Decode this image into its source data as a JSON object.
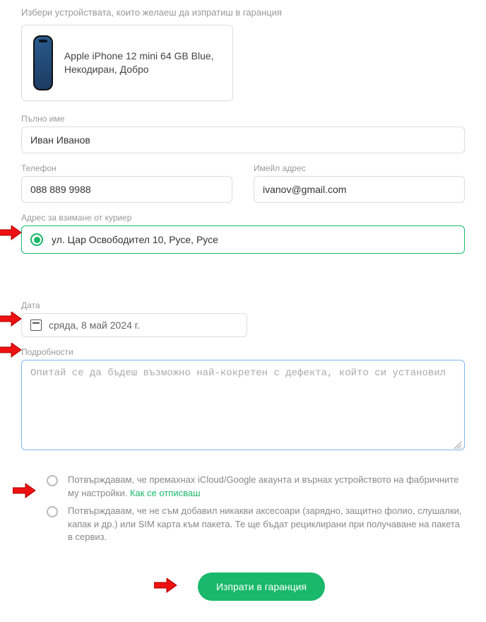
{
  "heading": "Избери устройствата, които желаеш да изпратиш в гаранция",
  "device": {
    "title": "Apple iPhone 12 mini 64 GB Blue, Некодиран, Добро"
  },
  "fields": {
    "full_name_label": "Пълно име",
    "full_name_value": "Иван Иванов",
    "phone_label": "Телефон",
    "phone_value": "088 889 9988",
    "email_label": "Имейл адрес",
    "email_value": "ivanov@gmail.com",
    "pickup_label": "Адрес за взимане от куриер",
    "pickup_value": "ул. Цар Освободител 10, Русе, Русе",
    "date_label": "Дата",
    "date_value": "сряда, 8 май 2024 г.",
    "details_label": "Подробности",
    "details_placeholder": "Опитай се да бъдеш възможно най-кокретен с дефекта, който си установил"
  },
  "confirmations": {
    "c1_a": "Потвърждавам, че премахнах iCloud/Google акаунта и върнах устройството на фабричните му настройки. ",
    "c1_link": "Как се отписваш",
    "c2": "Потвърждавам, че не съм добавил никакви аксесоари (зарядно, защитно фолио, слушалки, капак и др.) или SIM карта към пакета. Те ще бъдат рециклирани при получаване на пакета в сервиз."
  },
  "submit_label": "Изпрати в гаранция"
}
